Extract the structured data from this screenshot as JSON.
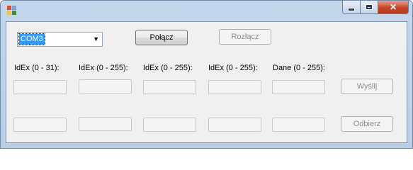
{
  "window": {
    "title": "",
    "icon": "form-app-icon",
    "controls": {
      "minimize": "minimize-icon",
      "maximize": "maximize-icon",
      "close": "close-icon"
    }
  },
  "connection": {
    "port_value": "COM3",
    "connect_label": "Połącz",
    "disconnect_label": "Rozłącz"
  },
  "fields": {
    "labels": [
      "IdEx (0 - 31):",
      "IdEx (0 - 255):",
      "IdEx (0 - 255):",
      "IdEx (0 - 255):",
      "Dane (0 - 255):"
    ],
    "send_row": [
      "",
      "",
      "",
      "",
      ""
    ],
    "receive_row": [
      "",
      "",
      "",
      "",
      ""
    ]
  },
  "actions": {
    "send_label": "Wyślij",
    "receive_label": "Odbierz"
  },
  "colors": {
    "selection": "#3399ff",
    "close_button": "#c7452c",
    "frame": "#b9cde6",
    "client_bg": "#f0f0f0"
  }
}
